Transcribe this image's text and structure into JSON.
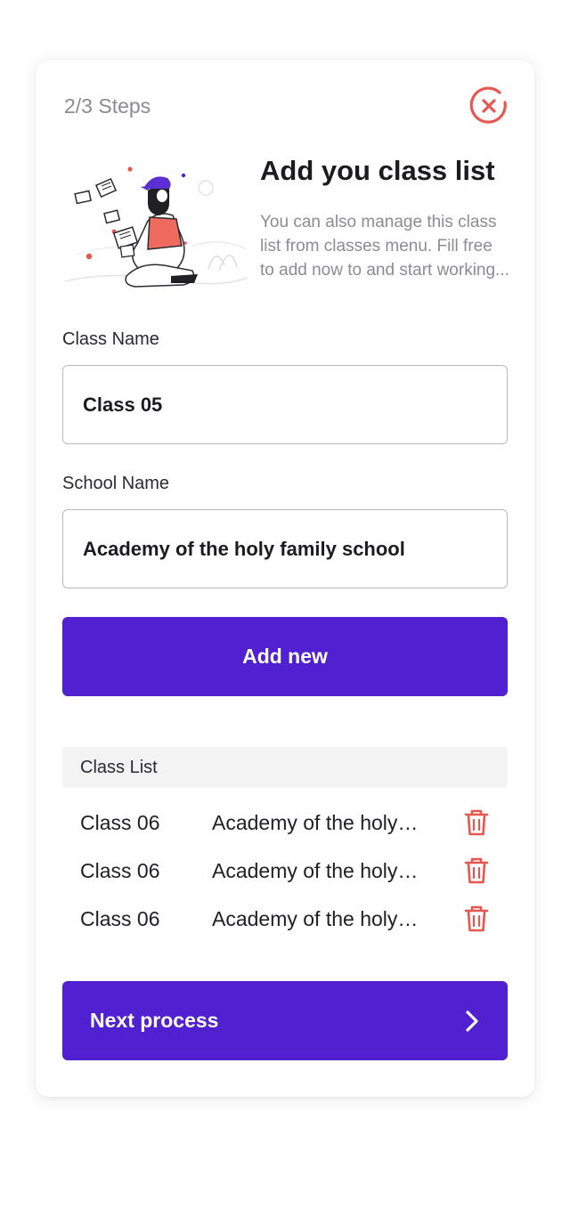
{
  "header": {
    "steps": "2/3 Steps",
    "title": "Add you class list",
    "description": "You can also manage this class list from classes menu. Fill free to add now to and start working..."
  },
  "form": {
    "class_name": {
      "label": "Class Name",
      "value": "Class 05"
    },
    "school_name": {
      "label": "School Name",
      "value": "Academy of the holy family school"
    },
    "add_button": "Add new"
  },
  "class_list": {
    "header": "Class List",
    "rows": [
      {
        "class": "Class 06",
        "school": "Academy of the holy family school"
      },
      {
        "class": "Class 06",
        "school": "Academy of the holy family school"
      },
      {
        "class": "Class 06",
        "school": "Academy of the holy family school"
      }
    ]
  },
  "footer": {
    "next_button": "Next process"
  },
  "colors": {
    "primary": "#5120d1",
    "danger": "#e5574f",
    "muted_text": "#8c8c92"
  },
  "icons": {
    "close": "close-circle-icon",
    "delete": "trash-icon",
    "next": "chevron-right-icon"
  }
}
